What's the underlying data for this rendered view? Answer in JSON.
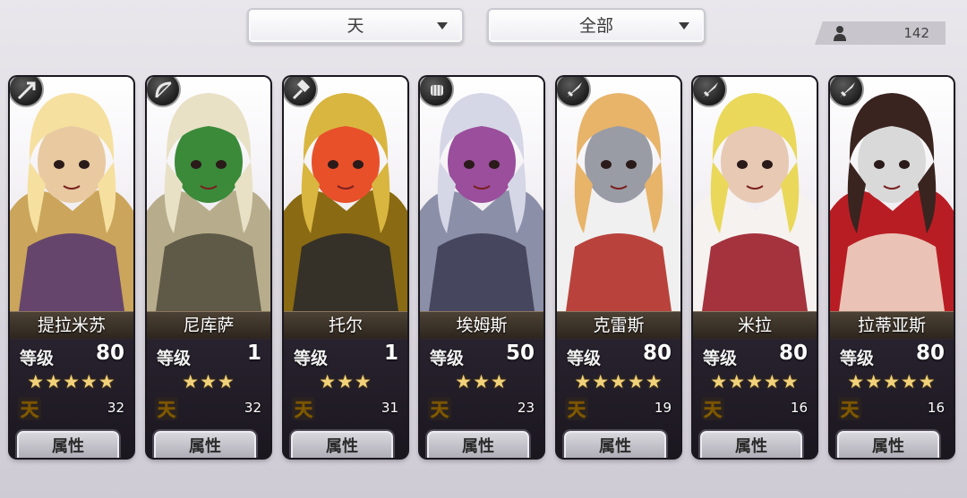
{
  "filters": {
    "rarity": {
      "value": "天"
    },
    "category": {
      "value": "全部"
    }
  },
  "counter": {
    "icon": "person-icon",
    "value": "142"
  },
  "cards": [
    {
      "name": "提拉米苏",
      "level_label": "等级",
      "level": "80",
      "stars": 5,
      "stars_text": "★★★★★",
      "tian_label": "天",
      "tian_count": "32",
      "button": "属性",
      "class_icon": "arrow-icon",
      "palette": [
        "#f6e0a0",
        "#caa55b",
        "#5b3b6e",
        "#e8c9a0"
      ]
    },
    {
      "name": "尼库萨",
      "level_label": "等级",
      "level": "1",
      "stars": 3,
      "stars_text": "★★★",
      "tian_label": "天",
      "tian_count": "32",
      "button": "属性",
      "class_icon": "bow-icon",
      "palette": [
        "#e8e1c6",
        "#b7ad8c",
        "#55503f",
        "#3b8a3a"
      ]
    },
    {
      "name": "托尔",
      "level_label": "等级",
      "level": "1",
      "stars": 3,
      "stars_text": "★★★",
      "tian_label": "天",
      "tian_count": "31",
      "button": "属性",
      "class_icon": "hammer-icon",
      "palette": [
        "#d9b640",
        "#8a6a12",
        "#2b2b2b",
        "#e8502a"
      ]
    },
    {
      "name": "埃姆斯",
      "level_label": "等级",
      "level": "50",
      "stars": 3,
      "stars_text": "★★★",
      "tian_label": "天",
      "tian_count": "23",
      "button": "属性",
      "class_icon": "fist-icon",
      "palette": [
        "#d6d7e6",
        "#8c8fa8",
        "#3e3f55",
        "#9a4e9c"
      ]
    },
    {
      "name": "克雷斯",
      "level_label": "等级",
      "level": "80",
      "stars": 5,
      "stars_text": "★★★★★",
      "tian_label": "天",
      "tian_count": "19",
      "button": "属性",
      "class_icon": "sword-icon",
      "palette": [
        "#e7b46a",
        "#f0f0f0",
        "#b33028",
        "#9a9ca5"
      ]
    },
    {
      "name": "米拉",
      "level_label": "等级",
      "level": "80",
      "stars": 5,
      "stars_text": "★★★★★",
      "tian_label": "天",
      "tian_count": "16",
      "button": "属性",
      "class_icon": "sword-icon",
      "palette": [
        "#e9d85a",
        "#f6f2f0",
        "#9b1e2a",
        "#e8c9b4"
      ]
    },
    {
      "name": "拉蒂亚斯",
      "level_label": "等级",
      "level": "80",
      "stars": 5,
      "stars_text": "★★★★★",
      "tian_label": "天",
      "tian_count": "16",
      "button": "属性",
      "class_icon": "sword-icon",
      "palette": [
        "#3a2420",
        "#b91d24",
        "#f0d6c6",
        "#d9d9d9"
      ]
    }
  ]
}
